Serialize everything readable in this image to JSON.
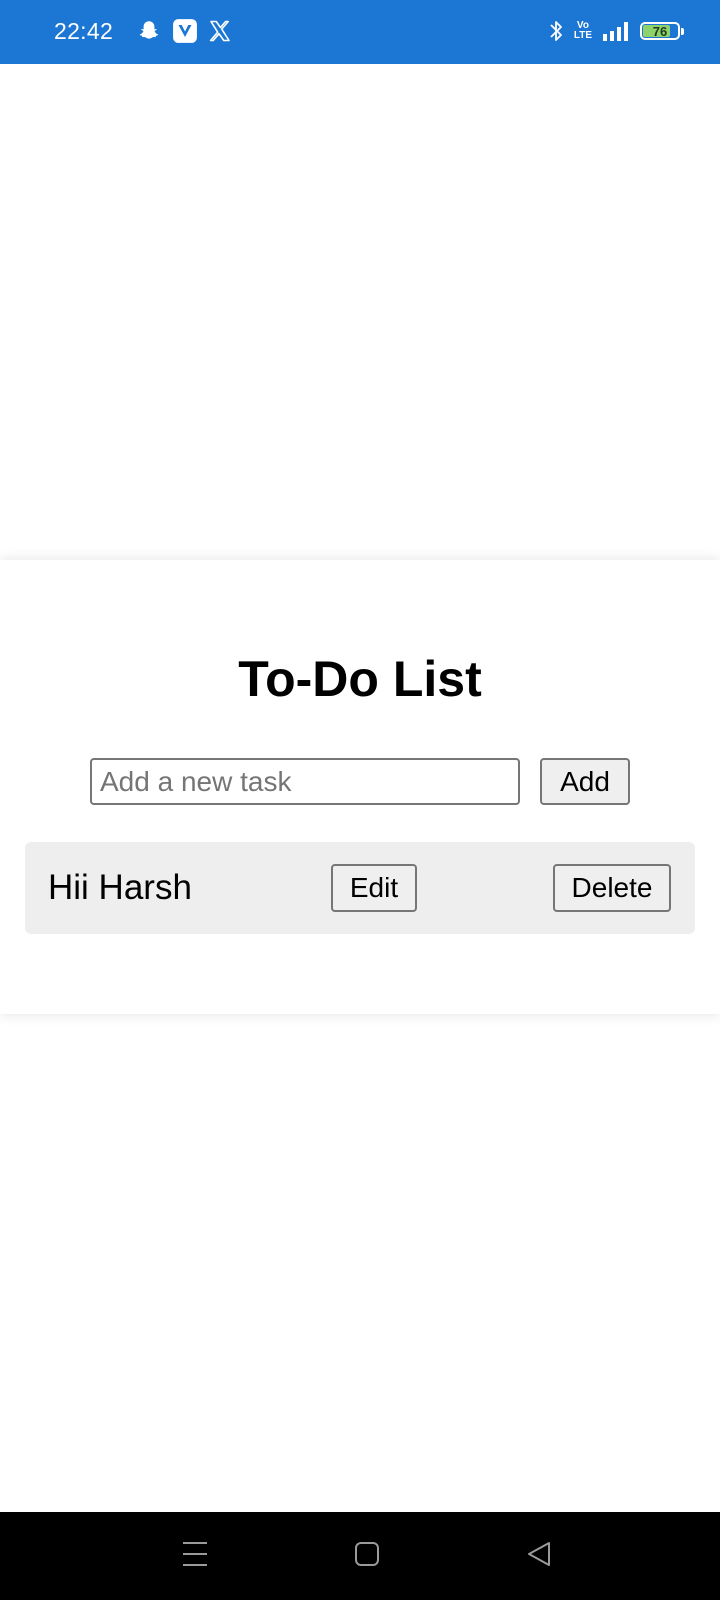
{
  "status_bar": {
    "time": "22:42",
    "left_icons": [
      "snapchat-icon",
      "v-app-icon",
      "x-icon"
    ],
    "right_icons": [
      "bluetooth-icon",
      "volte-icon",
      "signal-icon",
      "battery-icon"
    ],
    "volte_top": "Vo",
    "volte_bottom": "LTE",
    "battery_level": "76",
    "background_color": "#1c77d4"
  },
  "app": {
    "title": "To-Do List",
    "input": {
      "value": "",
      "placeholder": "Add a new task"
    },
    "add_label": "Add",
    "tasks": [
      {
        "text": "Hii Harsh",
        "edit_label": "Edit",
        "delete_label": "Delete"
      }
    ]
  },
  "nav_bar": {
    "items": [
      "recents-icon",
      "home-icon",
      "back-icon"
    ]
  }
}
